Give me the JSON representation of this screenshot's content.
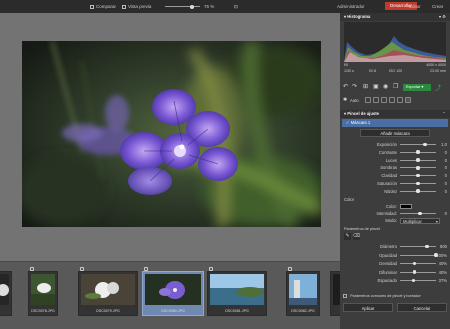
{
  "topbar": {
    "compare_label": "Comparar",
    "preview_label": "Vista previa",
    "zoom_value": "75 %",
    "tabs": [
      "Administrador",
      "Desarrollar",
      "Editor",
      "Crear"
    ]
  },
  "histogram": {
    "title": "Histograma",
    "exposure_info": [
      "f/5",
      "1/30 s",
      "f/2.8",
      "ISO 100",
      "4000 x 4000",
      "23.00 mm"
    ]
  },
  "toolbar": {
    "auto_label": "Auto",
    "export_label": "Exportar"
  },
  "adjust_brush": {
    "title": "Pincel de ajuste",
    "mask_label": "Máscara 1",
    "add_mask_label": "Añadir máscara",
    "sliders": [
      {
        "label": "Exposición",
        "value": "1.0",
        "level": 0.7
      },
      {
        "label": "Contraste",
        "value": "0",
        "level": 0.5
      },
      {
        "label": "Luces",
        "value": "0",
        "level": 0.5
      },
      {
        "label": "Sombras",
        "value": "0",
        "level": 0.5
      },
      {
        "label": "Claridad",
        "value": "0",
        "level": 0.5
      },
      {
        "label": "Saturación",
        "value": "0",
        "level": 0.5
      },
      {
        "label": "Nitidez",
        "value": "0",
        "level": 0.5
      }
    ],
    "color_section": "Color",
    "color_label": "Color:",
    "intensity_label": "Intensidad:",
    "intensity_value": "0",
    "mode_label": "Modo:",
    "mode_value": "Multiplicar",
    "brush_params_label": "Parámetros de pincel",
    "brush_sliders": [
      {
        "label": "Diámetro",
        "value": "800",
        "level": 0.75
      },
      {
        "label": "Opacidad",
        "value": "100%",
        "level": 1.0
      },
      {
        "label": "Densidad",
        "value": "40%",
        "level": 0.4
      },
      {
        "label": "Difuminar",
        "value": "40%",
        "level": 0.4
      },
      {
        "label": "Espaciado",
        "value": "37%",
        "level": 0.37
      }
    ],
    "common_params_label": "Parámetros comunes de pincel y borrador",
    "apply_label": "Aplicar",
    "cancel_label": "Cancelar"
  },
  "filmstrip": {
    "thumbs": [
      {
        "caption": "",
        "selected": false
      },
      {
        "caption": "DSC0078.JPG",
        "selected": false
      },
      {
        "caption": "DSC0079.JPG",
        "selected": false
      },
      {
        "caption": "DSC0080.JPG",
        "selected": true
      },
      {
        "caption": "DSC0081.JPG",
        "selected": false
      },
      {
        "caption": "DSC0082.JPG",
        "selected": false
      },
      {
        "caption": "",
        "selected": false
      }
    ]
  }
}
